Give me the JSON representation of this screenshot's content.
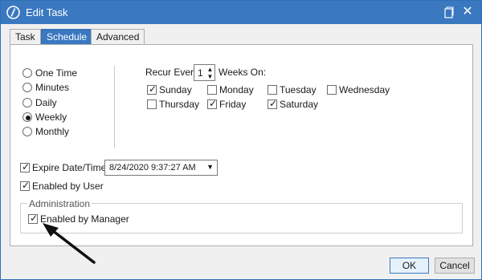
{
  "window": {
    "title": "Edit Task"
  },
  "tabs": [
    {
      "label": "Task",
      "active": false
    },
    {
      "label": "Schedule",
      "active": true
    },
    {
      "label": "Advanced",
      "active": false
    }
  ],
  "frequency": {
    "options": [
      "One Time",
      "Minutes",
      "Daily",
      "Weekly",
      "Monthly"
    ],
    "selected": "Weekly"
  },
  "recur": {
    "label": "Recur Every:",
    "value": "1",
    "weeks_label": "Weeks On:"
  },
  "days": [
    {
      "label": "Sunday",
      "checked": true
    },
    {
      "label": "Monday",
      "checked": false
    },
    {
      "label": "Tuesday",
      "checked": false
    },
    {
      "label": "Wednesday",
      "checked": false
    },
    {
      "label": "Thursday",
      "checked": false
    },
    {
      "label": "Friday",
      "checked": true
    },
    {
      "label": "Saturday",
      "checked": true
    }
  ],
  "expire": {
    "label": "Expire Date/Time:",
    "checked": true,
    "value": "8/24/2020 9:37:27 AM"
  },
  "enabled_by_user": {
    "label": "Enabled by User",
    "checked": true
  },
  "administration": {
    "group_label": "Administration",
    "enabled_by_manager": {
      "label": "Enabled by Manager",
      "checked": true
    }
  },
  "buttons": {
    "ok": "OK",
    "cancel": "Cancel"
  },
  "colors": {
    "titlebar": "#3a78c0",
    "accent": "#2f6fb5"
  },
  "icons": [
    "app-logo-icon",
    "restore-icon",
    "close-icon",
    "chevron-up-icon",
    "chevron-down-icon",
    "dropdown-caret-icon",
    "annotation-arrow"
  ]
}
